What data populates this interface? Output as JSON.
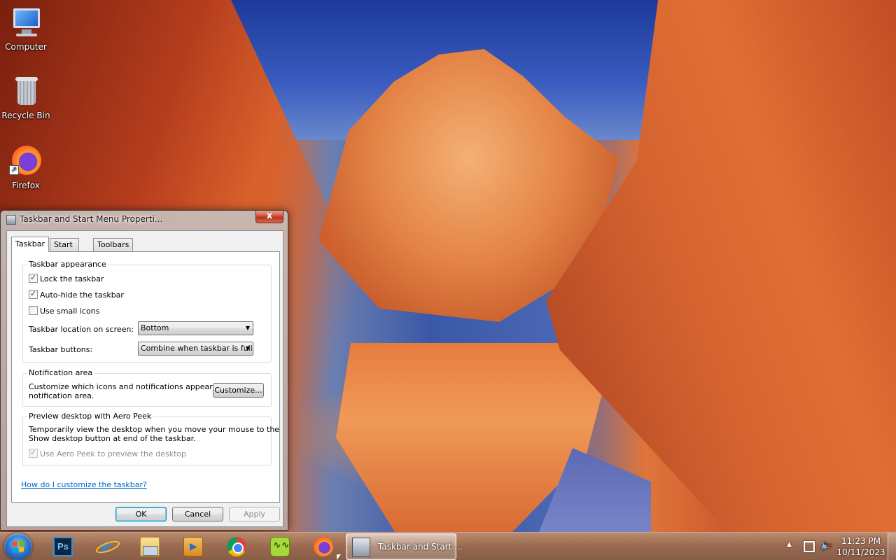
{
  "desktop": {
    "icons": [
      {
        "label": "Computer",
        "icon": "computer-icon"
      },
      {
        "label": "Recycle Bin",
        "icon": "recycle-bin-icon"
      },
      {
        "label": "Firefox",
        "icon": "firefox-icon"
      }
    ]
  },
  "dialog": {
    "title": "Taskbar and Start Menu Properti...",
    "close_label": "x",
    "tabs": [
      {
        "label": "Taskbar",
        "active": true
      },
      {
        "label": "Start Menu",
        "active": false
      },
      {
        "label": "Toolbars",
        "active": false
      }
    ],
    "appearance": {
      "title": "Taskbar appearance",
      "lock_label": "Lock the taskbar",
      "lock_checked": true,
      "autohide_label": "Auto-hide the taskbar",
      "autohide_checked": true,
      "small_icons_label": "Use small icons",
      "small_icons_checked": false,
      "location_label": "Taskbar location on screen:",
      "location_value": "Bottom",
      "buttons_label": "Taskbar buttons:",
      "buttons_value": "Combine when taskbar is full"
    },
    "notification": {
      "title": "Notification area",
      "text_line1": "Customize which icons and notifications appear in the",
      "text_line2": "notification area.",
      "customize_button": "Customize..."
    },
    "aero_peek": {
      "title": "Preview desktop with Aero Peek",
      "text_line1": "Temporarily view the desktop when you move your mouse to the",
      "text_line2": "Show desktop button at end of the taskbar.",
      "checkbox_label": "Use Aero Peek to preview the desktop",
      "checkbox_checked": true,
      "checkbox_disabled": true
    },
    "help_link": "How do I customize the taskbar?",
    "buttons": {
      "ok": "OK",
      "cancel": "Cancel",
      "apply": "Apply"
    }
  },
  "taskbar": {
    "pinned": [
      {
        "name": "photoshop",
        "icon": "photoshop-icon",
        "text": "Ps"
      },
      {
        "name": "internet-explorer",
        "icon": "internet-explorer-icon",
        "text": "e"
      },
      {
        "name": "file-explorer",
        "icon": "folder-icon"
      },
      {
        "name": "media-player",
        "icon": "media-player-icon"
      },
      {
        "name": "chrome",
        "icon": "chrome-icon"
      },
      {
        "name": "green-app",
        "icon": "green-app-icon"
      },
      {
        "name": "firefox",
        "icon": "firefox-icon"
      }
    ],
    "active_window": "Taskbar and Start ...",
    "clock_time": "11:23 PM",
    "clock_date": "10/11/2023"
  }
}
